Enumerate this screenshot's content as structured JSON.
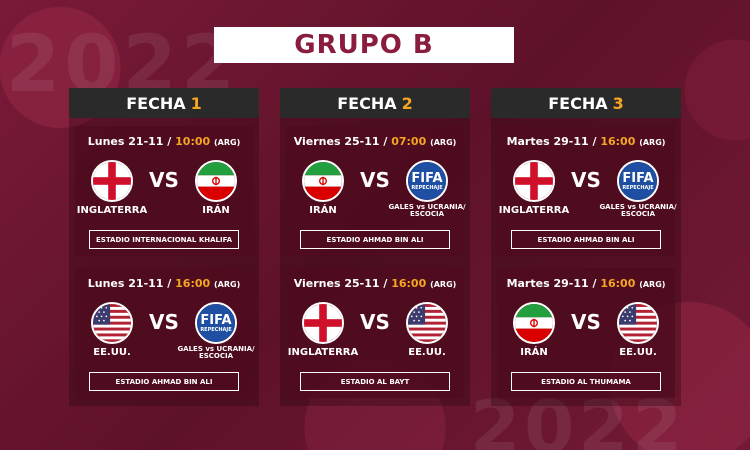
{
  "title": "GRUPO B",
  "watermark": "2022",
  "colors": {
    "accent": "#f5a623",
    "brand": "#8a1c3e",
    "background": "#6b1630"
  },
  "fechas": [
    {
      "label": "FECHA",
      "number": "1",
      "matches": [
        {
          "day": "Lunes 21-11 /",
          "time": "10:00",
          "zone": "(ARG)",
          "home": "INGLATERRA",
          "home_flag": "england-flag-icon",
          "away": "IRÁN",
          "away_flag": "iran-flag-icon",
          "vs": "VS",
          "stadium": "ESTADIO INTERNACIONAL KHALIFA"
        },
        {
          "day": "Lunes 21-11 /",
          "time": "16:00",
          "zone": "(ARG)",
          "home": "EE.UU.",
          "home_flag": "usa-flag-icon",
          "away": "GALES vs UCRANIA/ ESCOCIA",
          "away_flag": "fifa-repechaje-icon",
          "vs": "VS",
          "stadium": "ESTADIO AHMAD BIN ALI"
        }
      ]
    },
    {
      "label": "FECHA",
      "number": "2",
      "matches": [
        {
          "day": "Viernes 25-11 /",
          "time": "07:00",
          "zone": "(ARG)",
          "home": "IRÁN",
          "home_flag": "iran-flag-icon",
          "away": "GALES vs UCRANIA/ ESCOCIA",
          "away_flag": "fifa-repechaje-icon",
          "vs": "VS",
          "stadium": "ESTADIO AHMAD BIN ALI"
        },
        {
          "day": "Viernes 25-11 /",
          "time": "16:00",
          "zone": "(ARG)",
          "home": "INGLATERRA",
          "home_flag": "england-flag-icon",
          "away": "EE.UU.",
          "away_flag": "usa-flag-icon",
          "vs": "VS",
          "stadium": "ESTADIO AL BAYT"
        }
      ]
    },
    {
      "label": "FECHA",
      "number": "3",
      "matches": [
        {
          "day": "Martes 29-11 /",
          "time": "16:00",
          "zone": "(ARG)",
          "home": "INGLATERRA",
          "home_flag": "england-flag-icon",
          "away": "GALES vs UCRANIA/ ESCOCIA",
          "away_flag": "fifa-repechaje-icon",
          "vs": "VS",
          "stadium": "ESTADIO AHMAD BIN ALI"
        },
        {
          "day": "Martes 29-11 /",
          "time": "16:00",
          "zone": "(ARG)",
          "home": "IRÁN",
          "home_flag": "iran-flag-icon",
          "away": "EE.UU.",
          "away_flag": "usa-flag-icon",
          "vs": "VS",
          "stadium": "ESTADIO AL THUMAMA"
        }
      ]
    }
  ],
  "fifa_badge": {
    "line1": "FIFA",
    "line2": "REPECHAJE"
  }
}
